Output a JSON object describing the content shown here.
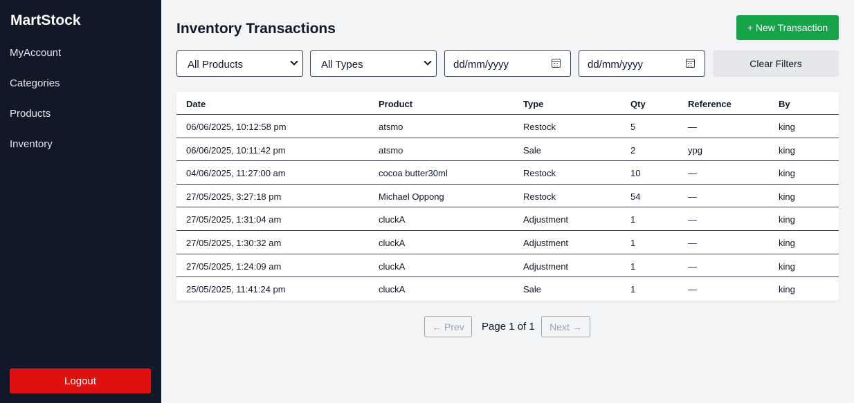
{
  "app": {
    "brand": "MartStock"
  },
  "sidebar": {
    "items": [
      {
        "label": "MyAccount"
      },
      {
        "label": "Categories"
      },
      {
        "label": "Products"
      },
      {
        "label": "Inventory"
      }
    ],
    "logout_label": "Logout"
  },
  "header": {
    "title": "Inventory Transactions",
    "new_button_label": "+ New Transaction"
  },
  "filters": {
    "product_select": "All Products",
    "type_select": "All Types",
    "date_from_placeholder": "dd/mm/yyyy",
    "date_to_placeholder": "dd/mm/yyyy",
    "clear_label": "Clear Filters"
  },
  "table": {
    "columns": [
      "Date",
      "Product",
      "Type",
      "Qty",
      "Reference",
      "By"
    ],
    "rows": [
      [
        "06/06/2025, 10:12:58 pm",
        "atsmo",
        "Restock",
        "5",
        "—",
        "king"
      ],
      [
        "06/06/2025, 10:11:42 pm",
        "atsmo",
        "Sale",
        "2",
        "ypg",
        "king"
      ],
      [
        "04/06/2025, 11:27:00 am",
        "cocoa butter30ml",
        "Restock",
        "10",
        "—",
        "king"
      ],
      [
        "27/05/2025, 3:27:18 pm",
        "Michael Oppong",
        "Restock",
        "54",
        "—",
        "king"
      ],
      [
        "27/05/2025, 1:31:04 am",
        "cluckA",
        "Adjustment",
        "1",
        "—",
        "king"
      ],
      [
        "27/05/2025, 1:30:32 am",
        "cluckA",
        "Adjustment",
        "1",
        "—",
        "king"
      ],
      [
        "27/05/2025, 1:24:09 am",
        "cluckA",
        "Adjustment",
        "1",
        "—",
        "king"
      ],
      [
        "25/05/2025, 11:41:24 pm",
        "cluckA",
        "Sale",
        "1",
        "—",
        "king"
      ]
    ]
  },
  "pagination": {
    "prev_label": "← Prev",
    "page_info": "Page 1 of 1",
    "next_label": "Next →"
  },
  "colors": {
    "sidebar_bg": "#111827",
    "primary_green": "#16a34a",
    "logout_red": "#e11010"
  }
}
